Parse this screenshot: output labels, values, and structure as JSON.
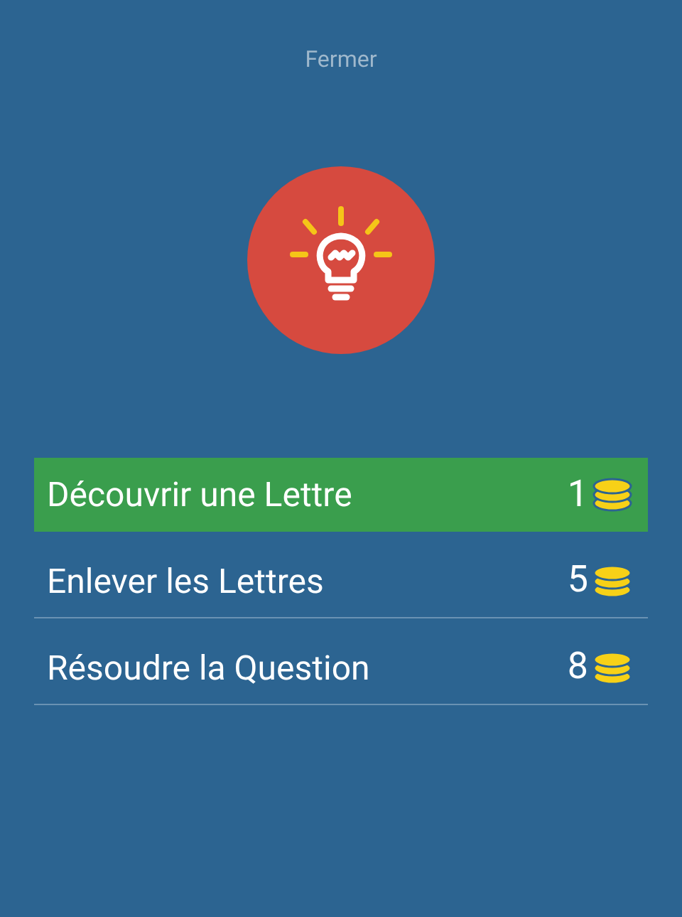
{
  "close_label": "Fermer",
  "options": [
    {
      "label": "Découvrir une Lettre",
      "cost": "1",
      "selected": true
    },
    {
      "label": "Enlever les Lettres",
      "cost": "5",
      "selected": false
    },
    {
      "label": "Résoudre la Question",
      "cost": "8",
      "selected": false
    }
  ]
}
